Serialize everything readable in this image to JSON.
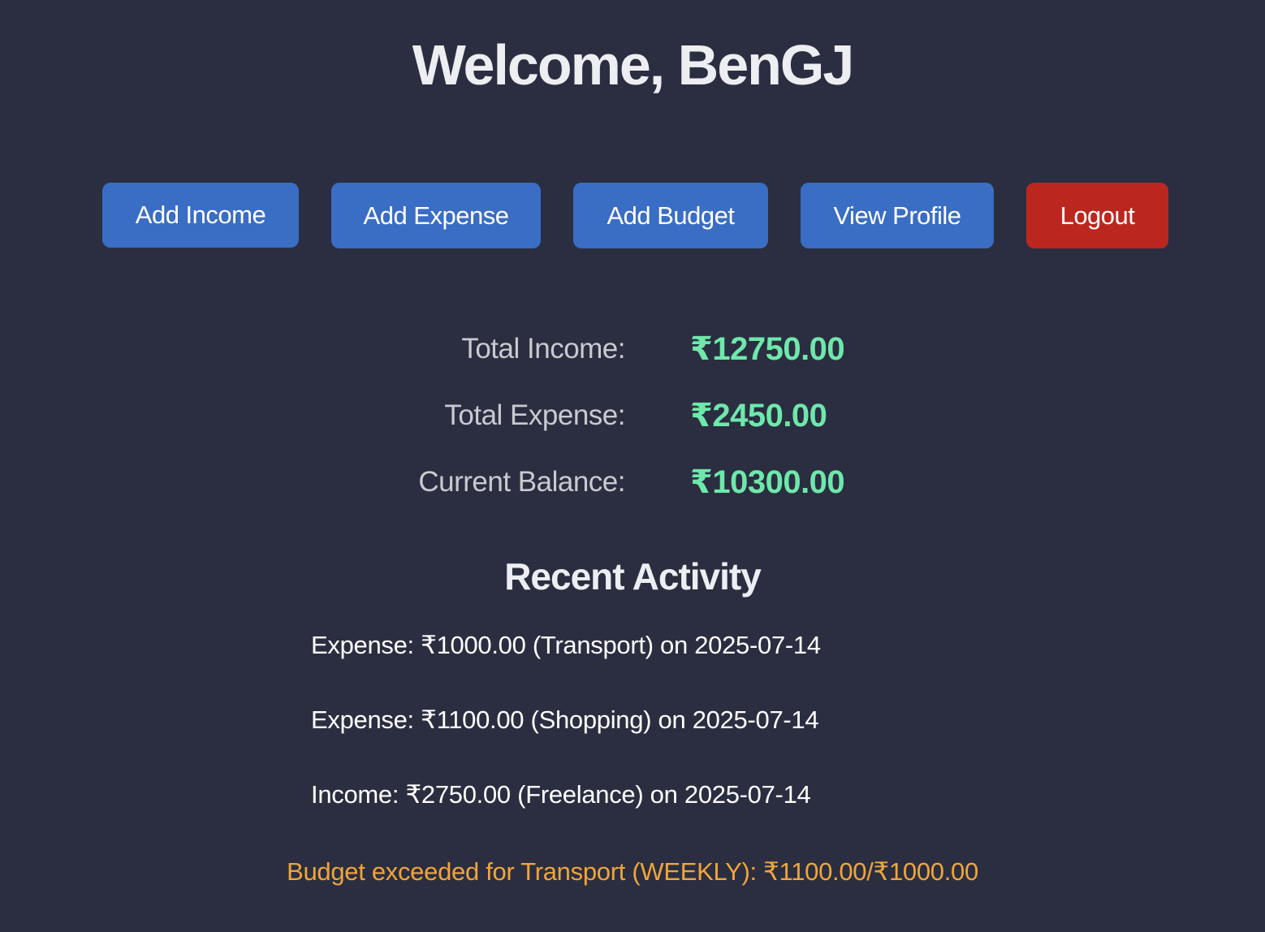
{
  "header": {
    "title": "Welcome, BenGJ"
  },
  "actions": {
    "add_income": "Add Income",
    "add_expense": "Add Expense",
    "add_budget": "Add Budget",
    "view_profile": "View Profile",
    "logout": "Logout"
  },
  "summary": {
    "total_income_label": "Total Income:",
    "total_income_value": "₹12750.00",
    "total_expense_label": "Total Expense:",
    "total_expense_value": "₹2450.00",
    "current_balance_label": "Current Balance:",
    "current_balance_value": "₹10300.00"
  },
  "recent_activity": {
    "title": "Recent Activity",
    "items": [
      "Expense: ₹1000.00 (Transport) on 2025-07-14",
      "Expense: ₹1100.00 (Shopping) on 2025-07-14",
      "Income: ₹2750.00 (Freelance) on 2025-07-14"
    ]
  },
  "alerts": {
    "budget_alert": "Budget exceeded for Transport (WEEKLY): ₹1100.00/₹1000.00"
  },
  "colors": {
    "background": "#2b2e40",
    "primary_button": "#3a6dc4",
    "danger_button": "#bb271f",
    "amount_green": "#6ee8ab",
    "warning_orange": "#f0a53b"
  }
}
